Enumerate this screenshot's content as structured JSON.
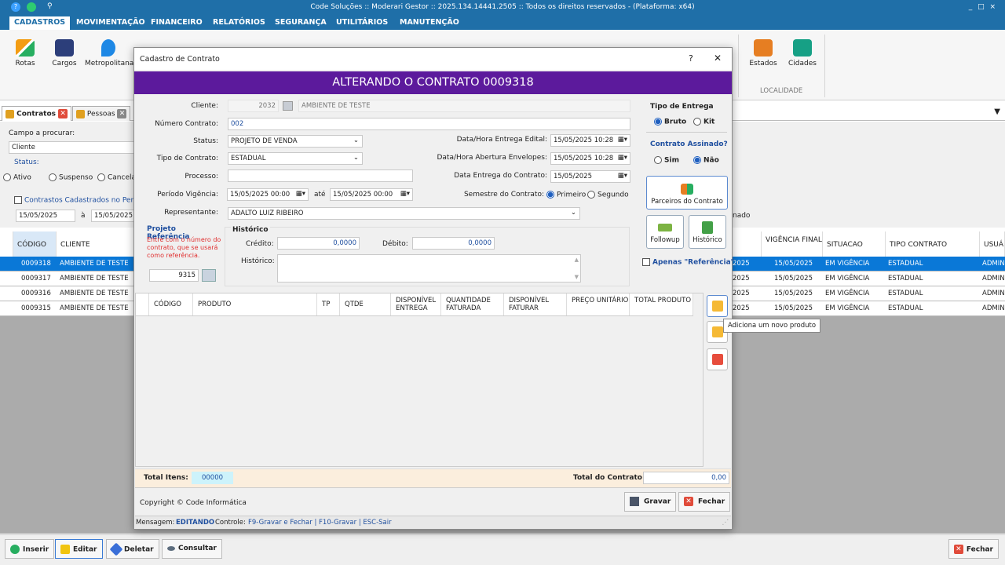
{
  "window": {
    "title": "Code Soluções :: Moderari Gestor :: 2025.134.14441.2505 :: Todos os direitos reservados - (Plataforma: x64)",
    "controls": "_ □ ×"
  },
  "menu": {
    "items": [
      "CADASTROS",
      "MOVIMENTAÇÃO",
      "FINANCEIRO",
      "RELATÓRIOS",
      "SEGURANÇA",
      "UTILITÁRIOS",
      "MANUTENÇÃO"
    ]
  },
  "ribbon": {
    "buttons": [
      "Rotas",
      "Cargos",
      "Metropolitana",
      "Estados",
      "Cidades"
    ],
    "group_label": "LOCALIDADE"
  },
  "doc_tabs": [
    "Contratos",
    "Pessoas"
  ],
  "search": {
    "field_label": "Campo a procurar:",
    "field_value": "Cliente",
    "status_label": "Status:",
    "status_options": [
      "Ativo",
      "Suspenso",
      "Cancela"
    ],
    "period_check": "Contrastos Cadastrados no Período",
    "date_from": "15/05/2025",
    "date_to_label": "à",
    "date_to": "15/05/2025",
    "nado": "nado"
  },
  "grid": {
    "left_headers": [
      "CÓDIGO",
      "CLIENTE"
    ],
    "right_headers": [
      "VIGÊNCIA FINAL",
      "SITUACAO",
      "TIPO CONTRATO",
      "USUÁ"
    ],
    "rows": [
      {
        "codigo": "0009318",
        "cliente": "AMBIENTE DE TESTE",
        "prev": "2025",
        "vig": "15/05/2025",
        "situacao": "EM VIGÊNCIA",
        "tipo": "ESTADUAL",
        "usuario": "ADMIN"
      },
      {
        "codigo": "0009317",
        "cliente": "AMBIENTE DE TESTE",
        "prev": "2025",
        "vig": "15/05/2025",
        "situacao": "EM VIGÊNCIA",
        "tipo": "ESTADUAL",
        "usuario": "ADMIN"
      },
      {
        "codigo": "0009316",
        "cliente": "AMBIENTE DE TESTE",
        "prev": "2025",
        "vig": "15/05/2025",
        "situacao": "EM VIGÊNCIA",
        "tipo": "ESTADUAL",
        "usuario": "ADMIN"
      },
      {
        "codigo": "0009315",
        "cliente": "AMBIENTE DE TESTE",
        "prev": "2025",
        "vig": "15/05/2025",
        "situacao": "EM VIGÊNCIA",
        "tipo": "ESTADUAL",
        "usuario": "ADMIN"
      }
    ]
  },
  "bottom": {
    "inserir": "Inserir",
    "editar": "Editar",
    "deletar": "Deletar",
    "consultar": "Consultar",
    "fechar": "Fechar"
  },
  "dialog": {
    "title": "Cadastro de Contrato",
    "help": "?",
    "close": "✕",
    "header": "ALTERANDO O CONTRATO 0009318",
    "cliente_label": "Cliente:",
    "cliente_code": "2032",
    "cliente_name": "AMBIENTE DE TESTE",
    "numero_label": "Número Contrato:",
    "numero_value": "002",
    "status_label": "Status:",
    "status_value": "PROJETO DE VENDA",
    "tipo_label": "Tipo de Contrato:",
    "tipo_value": "ESTADUAL",
    "processo_label": "Processo:",
    "processo_value": "",
    "periodo_label": "Período Vigência:",
    "periodo_from": "15/05/2025 00:00",
    "periodo_ate": "até",
    "periodo_to": "15/05/2025 00:00",
    "representante_label": "Representante:",
    "representante_value": "ADALTO LUIZ RIBEIRO",
    "edital_label": "Data/Hora Entrega Edital:",
    "edital_value": "15/05/2025 10:28",
    "envelopes_label": "Data/Hora Abertura Envelopes:",
    "envelopes_value": "15/05/2025 10:28",
    "entrega_label": "Data Entrega do Contrato:",
    "entrega_value": "15/05/2025",
    "semestre_label": "Semestre do Contrato:",
    "semestre_primeiro": "Primeiro",
    "semestre_segundo": "Segundo",
    "tipo_entrega_title": "Tipo de Entrega",
    "bruto": "Bruto",
    "kit": "Kit",
    "assinado_title": "Contrato Assinado?",
    "sim": "Sim",
    "nao": "Não",
    "parceiros": "Parceiros do Contrato",
    "followup": "Followup",
    "historico_btn": "Histórico",
    "apenas_ref": "Apenas \"Referência\"",
    "projeto_title": "Projeto Referência",
    "projeto_hint": "Entre com o número do contrato, que se usará como referência.",
    "projeto_value": "9315",
    "historico_title": "Histórico",
    "credito_label": "Crédito:",
    "credito_value": "0,0000",
    "debito_label": "Débito:",
    "debito_value": "0,0000",
    "historico_label": "Histórico:",
    "products_headers": [
      "CÓDIGO",
      "PRODUTO",
      "TP",
      "QTDE",
      "DISPONÍVEL ENTREGA",
      "QUANTIDADE FATURADA",
      "DISPONÍVEL FATURAR",
      "PREÇO UNITÁRIO",
      "TOTAL PRODUTO"
    ],
    "tooltip": "Adiciona um novo produto",
    "total_itens_label": "Total Itens:",
    "total_itens_value": "00000",
    "total_contrato_label": "Total do Contrato:",
    "total_contrato_value": "0,00",
    "copyright": "Copyright © Code Informática",
    "gravar": "Gravar",
    "fechar": "Fechar",
    "status_msg_label": "Mensagem:",
    "status_msg_value": "EDITANDO",
    "controle_label": "Controle:",
    "controle_value": "F9-Gravar e Fechar | F10-Gravar | ESC-Sair"
  },
  "colors": {
    "accent": "#1f6fa8",
    "header_purple": "#5c1a9c",
    "selection": "#0a78d7"
  }
}
